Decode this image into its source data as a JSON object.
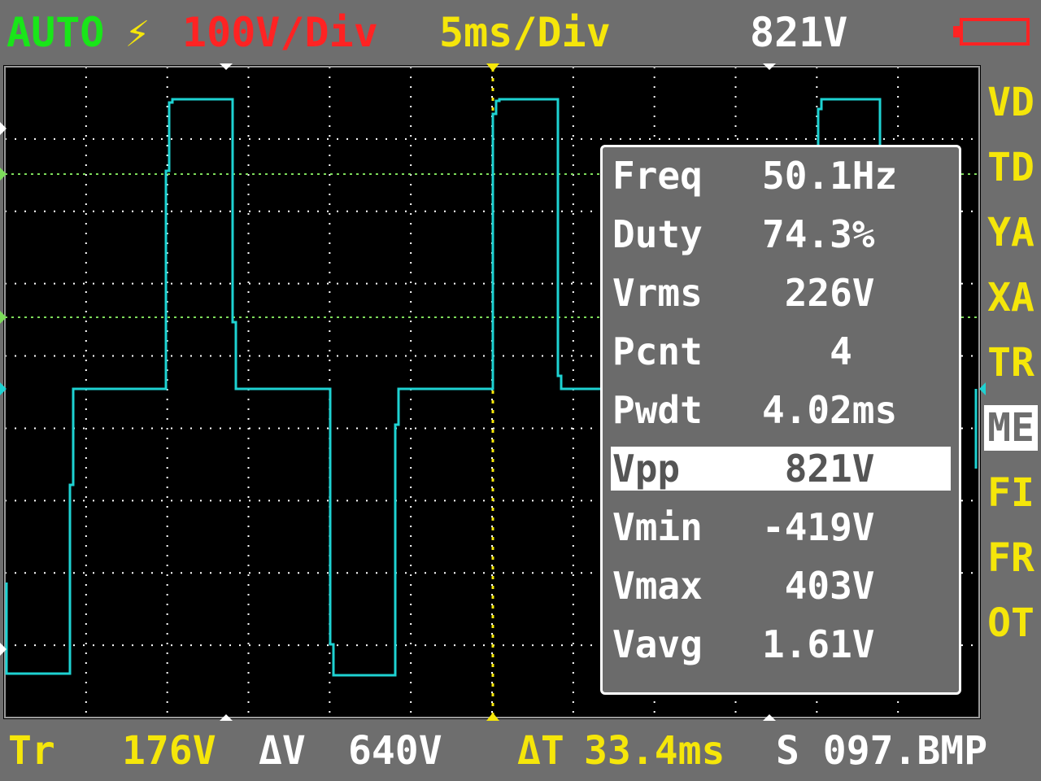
{
  "header": {
    "mode": "AUTO",
    "trigger_symbol": "⚡",
    "volts_per_div": "100V/Div",
    "time_per_div": "5ms/Div",
    "voltage_reading": "821V"
  },
  "colors": {
    "mode": "#19e619",
    "volts_per_div": "#ff2323",
    "time_per_div": "#f5e60a",
    "trace": "#1ed2d2",
    "grid": "#ffffff",
    "ref_lines": "#7ddc5a",
    "menu": "#f5e60a",
    "battery": "#ff2323"
  },
  "side_menu": [
    {
      "label": "VD",
      "active": false
    },
    {
      "label": "TD",
      "active": false
    },
    {
      "label": "YA",
      "active": false
    },
    {
      "label": "XA",
      "active": false
    },
    {
      "label": "TR",
      "active": false
    },
    {
      "label": "ME",
      "active": true
    },
    {
      "label": "FI",
      "active": false
    },
    {
      "label": "FR",
      "active": false
    },
    {
      "label": "OT",
      "active": false
    }
  ],
  "measurements": [
    {
      "label": "Freq",
      "value": "50.1Hz",
      "selected": false
    },
    {
      "label": "Duty",
      "value": "74.3%",
      "selected": false
    },
    {
      "label": "Vrms",
      "value": " 226V",
      "selected": false
    },
    {
      "label": "Pcnt",
      "value": "   4",
      "selected": false
    },
    {
      "label": "Pwdt",
      "value": "4.02ms",
      "selected": false
    },
    {
      "label": "Vpp",
      "value": " 821V",
      "selected": true
    },
    {
      "label": "Vmin",
      "value": "-419V",
      "selected": false
    },
    {
      "label": "Vmax",
      "value": " 403V",
      "selected": false
    },
    {
      "label": "Vavg",
      "value": "1.61V",
      "selected": false
    }
  ],
  "footer": {
    "trigger_label": "Tr",
    "trigger_value": "176V",
    "delta_v_label": "ΔV",
    "delta_v_value": "640V",
    "delta_t_label": "ΔT",
    "delta_t_value": "33.4ms",
    "file_name": "S 097.BMP"
  }
}
